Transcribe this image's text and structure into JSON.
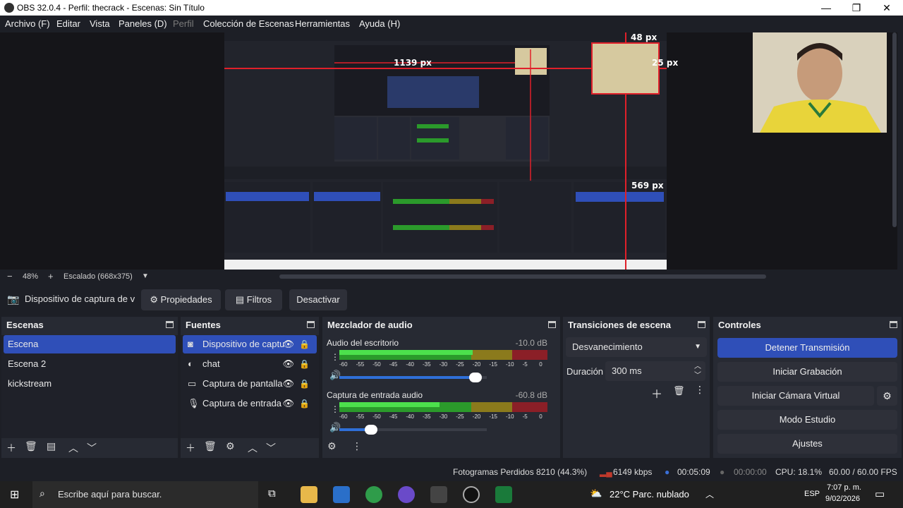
{
  "window": {
    "title": "OBS 32.0.4 - Perfil: thecrack - Escenas: Sin Título",
    "min": "—",
    "max": "❐",
    "close": "✕"
  },
  "menu": {
    "archivo": "Archivo (F)",
    "editar": "Editar",
    "vista": "Vista",
    "paneles": "Paneles (D)",
    "perfil": "Perfil",
    "coleccion": "Colección de Escenas",
    "herramientas": "Herramientas",
    "ayuda": "Ayuda (H)"
  },
  "preview": {
    "label_top": "48 px",
    "label_right": "25 px",
    "label_left": "1139 px",
    "label_bottom": "569 px"
  },
  "zoom": {
    "minus": "−",
    "value": "48%",
    "plus": "+",
    "scaling": "Escalado (668x375)",
    "dropdown": "▼"
  },
  "source_bar": {
    "source_name": "Dispositivo de captura de v",
    "properties": "Propiedades",
    "filters": "Filtros",
    "deactivate": "Desactivar"
  },
  "scenes": {
    "title": "Escenas",
    "items": [
      "Escena",
      "Escena 2",
      "kickstream"
    ]
  },
  "sources": {
    "title": "Fuentes",
    "items": [
      {
        "label": "Dispositivo de captu",
        "icon": "camera-icon"
      },
      {
        "label": "chat",
        "icon": "browser-icon"
      },
      {
        "label": "Captura de pantalla",
        "icon": "monitor-icon"
      },
      {
        "label": "Captura de entrada",
        "icon": "mic-icon"
      }
    ]
  },
  "mixer": {
    "title": "Mezclador de audio",
    "channels": [
      {
        "name": "Audio del escritorio",
        "db": "-10.0 dB",
        "level": 0.64,
        "volume": 0.9
      },
      {
        "name": "Captura de entrada audio",
        "db": "-60.8 dB",
        "level": 0.48,
        "volume": 0.2
      }
    ],
    "ticks": [
      "-60",
      "-55",
      "-50",
      "-45",
      "-40",
      "-35",
      "-30",
      "-25",
      "-20",
      "-15",
      "-10",
      "-5",
      "0"
    ]
  },
  "transitions": {
    "title": "Transiciones de escena",
    "selected": "Desvanecimiento",
    "duration_label": "Duración",
    "duration_value": "300 ms"
  },
  "controls": {
    "title": "Controles",
    "stop_stream": "Detener Transmisión",
    "start_recording": "Iniciar Grabación",
    "virtual_cam": "Iniciar Cámara Virtual",
    "studio_mode": "Modo Estudio",
    "settings": "Ajustes"
  },
  "status": {
    "dropped": "Fotogramas Perdidos 8210 (44.3%)",
    "bitrate": "6149 kbps",
    "stream_time": "00:05:09",
    "rec_time": "00:00:00",
    "cpu": "CPU: 18.1%",
    "fps": "60.00 / 60.00 FPS"
  },
  "taskbar": {
    "search_placeholder": "Escribe aquí para buscar.",
    "weather": "22°C  Parc. nublado",
    "lang": "ESP",
    "time": "7:07 p. m.",
    "date": "9/02/2026"
  },
  "colors": {
    "accent": "#2f4fb8",
    "background": "#1d1f26",
    "dock": "#272a33"
  }
}
